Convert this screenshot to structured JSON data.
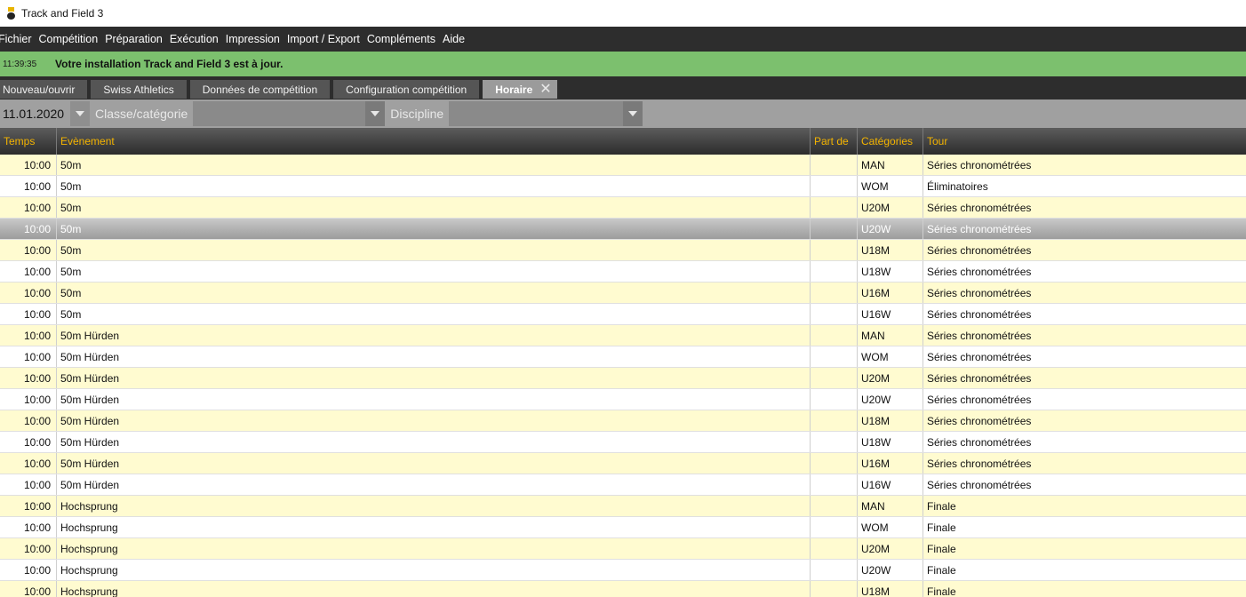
{
  "window": {
    "title": "Track and Field 3"
  },
  "menu": [
    "Fichier",
    "Compétition",
    "Préparation",
    "Exécution",
    "Impression",
    "Import / Export",
    "Compléments",
    "Aide"
  ],
  "status": {
    "time": "11:39:35",
    "message": "Votre installation Track and Field 3 est à jour."
  },
  "tabs": [
    "Nouveau/ouvrir",
    "Swiss Athletics",
    "Données de compétition",
    "Configuration compétition",
    "Horaire"
  ],
  "filters": {
    "date": "11.01.2020",
    "class_label": "Classe/catégorie",
    "class_value": "",
    "discipline_label": "Discipline",
    "discipline_value": ""
  },
  "columns": {
    "time": "Temps",
    "event": "Evènement",
    "part": "Part de",
    "category": "Catégories",
    "round": "Tour"
  },
  "rows": [
    {
      "time": "10:00",
      "event": "50m",
      "part": "",
      "category": "MAN",
      "round": "Séries chronométrées"
    },
    {
      "time": "10:00",
      "event": "50m",
      "part": "",
      "category": "WOM",
      "round": "Éliminatoires"
    },
    {
      "time": "10:00",
      "event": "50m",
      "part": "",
      "category": "U20M",
      "round": "Séries chronométrées"
    },
    {
      "time": "10:00",
      "event": "50m",
      "part": "",
      "category": "U20W",
      "round": "Séries chronométrées",
      "selected": true
    },
    {
      "time": "10:00",
      "event": "50m",
      "part": "",
      "category": "U18M",
      "round": "Séries chronométrées"
    },
    {
      "time": "10:00",
      "event": "50m",
      "part": "",
      "category": "U18W",
      "round": "Séries chronométrées"
    },
    {
      "time": "10:00",
      "event": "50m",
      "part": "",
      "category": "U16M",
      "round": "Séries chronométrées"
    },
    {
      "time": "10:00",
      "event": "50m",
      "part": "",
      "category": "U16W",
      "round": "Séries chronométrées"
    },
    {
      "time": "10:00",
      "event": "50m Hürden",
      "part": "",
      "category": "MAN",
      "round": "Séries chronométrées"
    },
    {
      "time": "10:00",
      "event": "50m Hürden",
      "part": "",
      "category": "WOM",
      "round": "Séries chronométrées"
    },
    {
      "time": "10:00",
      "event": "50m Hürden",
      "part": "",
      "category": "U20M",
      "round": "Séries chronométrées"
    },
    {
      "time": "10:00",
      "event": "50m Hürden",
      "part": "",
      "category": "U20W",
      "round": "Séries chronométrées"
    },
    {
      "time": "10:00",
      "event": "50m Hürden",
      "part": "",
      "category": "U18M",
      "round": "Séries chronométrées"
    },
    {
      "time": "10:00",
      "event": "50m Hürden",
      "part": "",
      "category": "U18W",
      "round": "Séries chronométrées"
    },
    {
      "time": "10:00",
      "event": "50m Hürden",
      "part": "",
      "category": "U16M",
      "round": "Séries chronométrées"
    },
    {
      "time": "10:00",
      "event": "50m Hürden",
      "part": "",
      "category": "U16W",
      "round": "Séries chronométrées"
    },
    {
      "time": "10:00",
      "event": "Hochsprung",
      "part": "",
      "category": "MAN",
      "round": "Finale"
    },
    {
      "time": "10:00",
      "event": "Hochsprung",
      "part": "",
      "category": "WOM",
      "round": "Finale"
    },
    {
      "time": "10:00",
      "event": "Hochsprung",
      "part": "",
      "category": "U20M",
      "round": "Finale"
    },
    {
      "time": "10:00",
      "event": "Hochsprung",
      "part": "",
      "category": "U20W",
      "round": "Finale"
    },
    {
      "time": "10:00",
      "event": "Hochsprung",
      "part": "",
      "category": "U18M",
      "round": "Finale"
    }
  ],
  "colors": {
    "accent": "#f4b400",
    "status_bg": "#7cc06e",
    "row_alt": "#fffbd0",
    "menu_bg": "#2d2d2d"
  },
  "icons": {
    "app": "track-and-field-logo-icon",
    "close_tab": "close-icon",
    "dropdown": "chevron-down-icon"
  }
}
